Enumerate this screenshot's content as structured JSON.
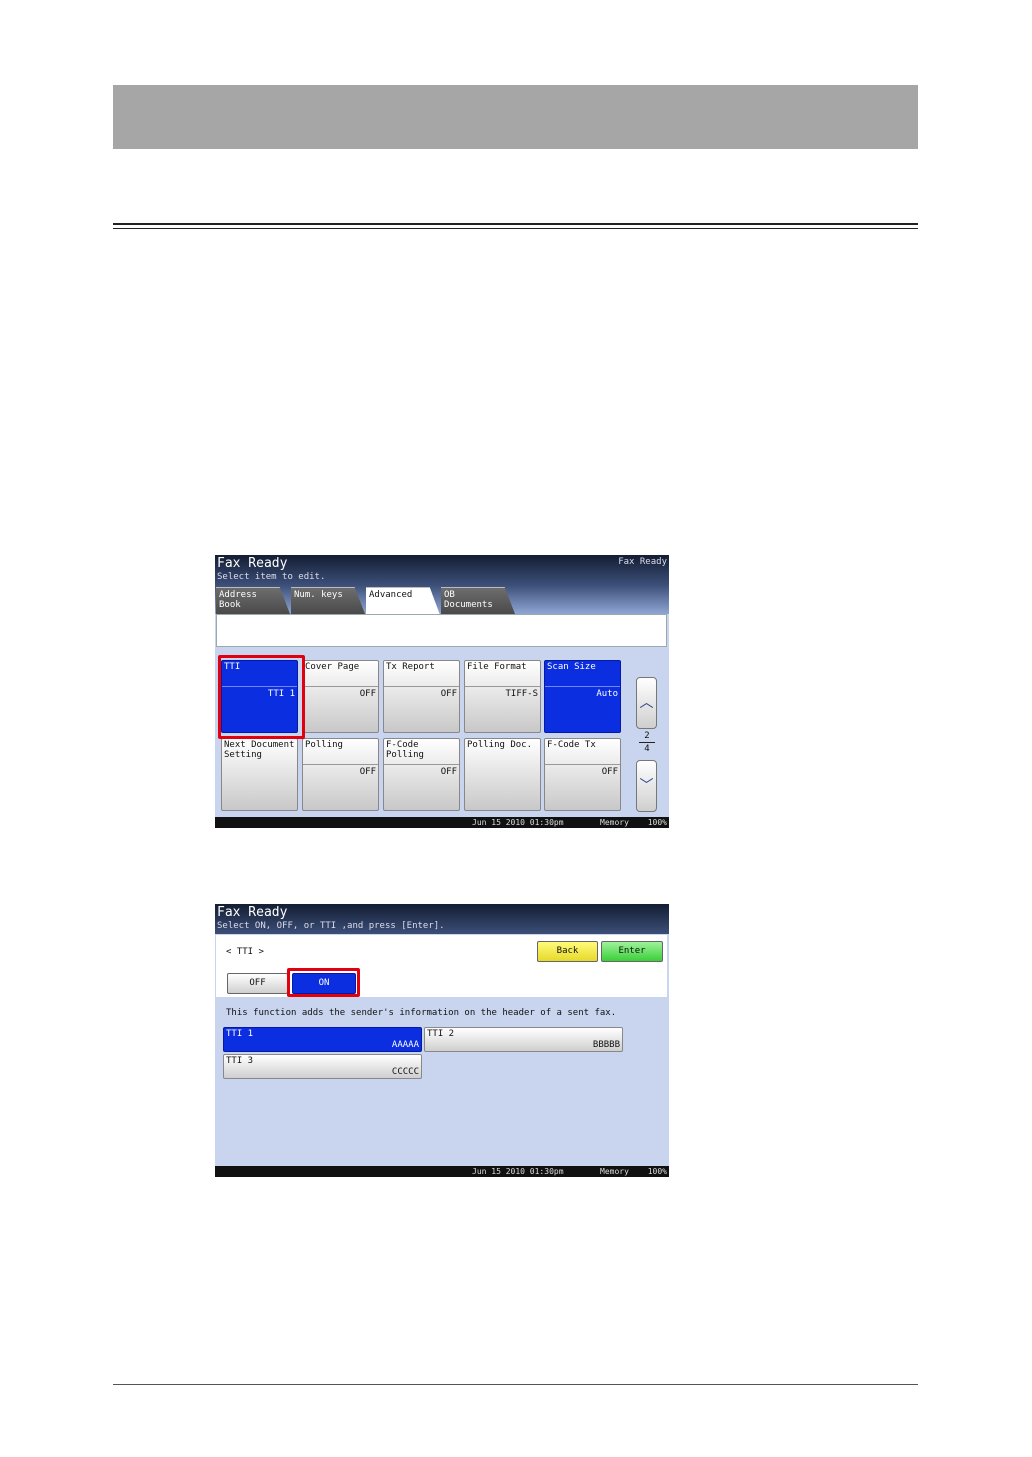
{
  "screen1": {
    "title": "Fax Ready",
    "subtitle": "Select item to edit.",
    "status_right": "Fax Ready",
    "tabs": [
      {
        "line1": "Address",
        "line2": "Book"
      },
      {
        "line1": "Num. keys",
        "line2": ""
      },
      {
        "line1": "Advanced",
        "line2": ""
      },
      {
        "line1": "OB",
        "line2": "Documents"
      }
    ],
    "buttons": [
      {
        "label": "TTI",
        "label2": "",
        "value": "TTI 1"
      },
      {
        "label": "Cover Page",
        "label2": "",
        "value": "OFF"
      },
      {
        "label": "Tx Report",
        "label2": "",
        "value": "OFF"
      },
      {
        "label": "File Format",
        "label2": "",
        "value": "TIFF-S"
      },
      {
        "label": "Scan Size",
        "label2": "",
        "value": "Auto"
      },
      {
        "label": "Next Document",
        "label2": "Setting",
        "value": ""
      },
      {
        "label": "Polling",
        "label2": "",
        "value": "OFF"
      },
      {
        "label": "F-Code Polling",
        "label2": "",
        "value": "OFF"
      },
      {
        "label": "Polling Doc.",
        "label2": "",
        "value": ""
      },
      {
        "label": "F-Code Tx",
        "label2": "",
        "value": "OFF"
      }
    ],
    "page_current": "2",
    "page_total": "4",
    "up_arrow": "︿",
    "down_arrow": "﹀",
    "status_date": "Jun 15 2010 01:30pm",
    "status_memory": "Memory",
    "status_percent": "100%"
  },
  "screen2": {
    "title": "Fax Ready",
    "subtitle": "Select ON, OFF, or TTI ,and press [Enter].",
    "setting_name": "< TTI >",
    "back_label": "Back",
    "enter_label": "Enter",
    "off_label": "OFF",
    "on_label": "ON",
    "description": "This function adds the sender's information on the header of a sent fax.",
    "tti_options": [
      {
        "name": "TTI 1",
        "value": "AAAAA"
      },
      {
        "name": "TTI 2",
        "value": "BBBBB"
      },
      {
        "name": "TTI 3",
        "value": "CCCCC"
      }
    ],
    "status_date": "Jun 15 2010 01:30pm",
    "status_memory": "Memory",
    "status_percent": "100%"
  },
  "colors": {
    "selected_blue": "#0b2ee0",
    "highlight_red": "#e00010",
    "header_gray": "#a6a6a6"
  }
}
